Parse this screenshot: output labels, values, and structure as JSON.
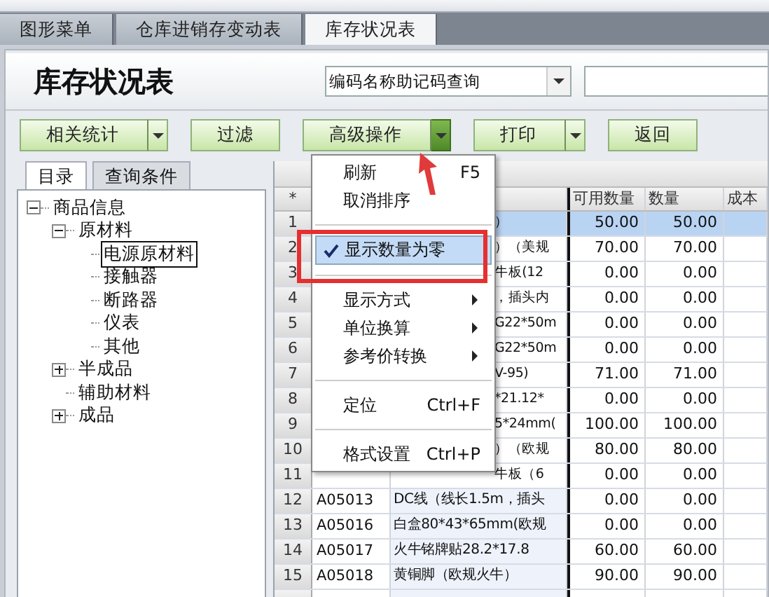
{
  "tabs": [
    {
      "label": "图形菜单",
      "selected": false
    },
    {
      "label": "仓库进销存变动表",
      "selected": false
    },
    {
      "label": "库存状况表",
      "selected": true
    }
  ],
  "header": {
    "title": "库存状况表",
    "query_combo": {
      "value": "编码名称助记码查询"
    }
  },
  "toolbar": [
    {
      "label": "相关统计",
      "dropdown": true,
      "pressed": false
    },
    {
      "label": "过滤",
      "dropdown": false
    },
    {
      "label": "高级操作",
      "dropdown": true,
      "pressed": true
    },
    {
      "label": "打印",
      "dropdown": true,
      "pressed": false
    },
    {
      "label": "返回",
      "dropdown": false
    }
  ],
  "left_tabs": [
    {
      "label": "目录",
      "selected": true
    },
    {
      "label": "查询条件",
      "selected": false
    }
  ],
  "tree": {
    "nodes": [
      {
        "label": "商品信息",
        "expanded": true,
        "selected": false,
        "children": [
          {
            "label": "原材料",
            "expanded": true,
            "selected": false,
            "children": [
              {
                "label": "电源原材料",
                "selected": true
              },
              {
                "label": "接触器",
                "selected": false
              },
              {
                "label": "断路器",
                "selected": false
              },
              {
                "label": "仪表",
                "selected": false
              },
              {
                "label": "其他",
                "selected": false
              }
            ]
          },
          {
            "label": "半成品",
            "expanded": false,
            "selected": false
          },
          {
            "label": "辅助材料",
            "selected": false
          },
          {
            "label": "成品",
            "expanded": false,
            "selected": false
          }
        ]
      }
    ]
  },
  "grid": {
    "number_header": "*",
    "columns": [
      "可用数量",
      "数量",
      "成本"
    ],
    "rows": [
      {
        "num": "1",
        "name": "）",
        "available": "50.00",
        "qty": "50.00",
        "selected": true
      },
      {
        "num": "2",
        "name": "）（美规",
        "available": "70.00",
        "qty": "70.00",
        "selected": false
      },
      {
        "num": "3",
        "name": "牛板(12",
        "available": "0.00",
        "qty": "0.00",
        "selected": false
      },
      {
        "num": "4",
        "name": "，插头内",
        "available": "0.00",
        "qty": "0.00",
        "selected": false
      },
      {
        "num": "5",
        "name": "G22*50m",
        "available": "0.00",
        "qty": "0.00",
        "selected": false
      },
      {
        "num": "6",
        "name": "G22*50m",
        "available": "0.00",
        "qty": "0.00",
        "selected": false
      },
      {
        "num": "7",
        "name": "V-95)",
        "available": "71.00",
        "qty": "71.00",
        "selected": false
      },
      {
        "num": "8",
        "name": "*21.12*",
        "available": "0.00",
        "qty": "0.00",
        "selected": false
      },
      {
        "num": "9",
        "name": "5*24mm(",
        "available": "100.00",
        "qty": "100.00",
        "selected": false
      },
      {
        "num": "10",
        "name": "）（欧规",
        "available": "80.00",
        "qty": "80.00",
        "selected": false
      },
      {
        "num": "11",
        "name": "牛板（6",
        "available": "0.00",
        "qty": "0.00",
        "selected": false
      },
      {
        "num": "12",
        "code": "A05013",
        "name": "DC线（线长1.5m，插头",
        "available": "0.00",
        "qty": "0.00",
        "selected": false
      },
      {
        "num": "13",
        "code": "A05016",
        "name": "白盒80*43*65mm(欧规",
        "available": "0.00",
        "qty": "0.00",
        "selected": false
      },
      {
        "num": "14",
        "code": "A05017",
        "name": "火牛铭牌贴28.2*17.8",
        "available": "60.00",
        "qty": "60.00",
        "selected": false
      },
      {
        "num": "15",
        "code": "A05018",
        "name": "黄铜脚（欧规火牛）",
        "available": "90.00",
        "qty": "90.00",
        "selected": false
      }
    ]
  },
  "context_menu": {
    "items": [
      {
        "kind": "item",
        "label": "刷新",
        "shortcut": "F5"
      },
      {
        "kind": "item",
        "label": "取消排序"
      },
      {
        "kind": "separator"
      },
      {
        "kind": "check",
        "label": "显示数量为零",
        "checked": true,
        "selected": true
      },
      {
        "kind": "separator"
      },
      {
        "kind": "submenu",
        "label": "显示方式"
      },
      {
        "kind": "submenu",
        "label": "单位换算"
      },
      {
        "kind": "submenu",
        "label": "参考价转换"
      },
      {
        "kind": "separator"
      },
      {
        "kind": "item",
        "label": "定位",
        "shortcut": "Ctrl+F"
      },
      {
        "kind": "separator"
      },
      {
        "kind": "item",
        "label": "格式设置",
        "shortcut": "Ctrl+P"
      }
    ]
  }
}
